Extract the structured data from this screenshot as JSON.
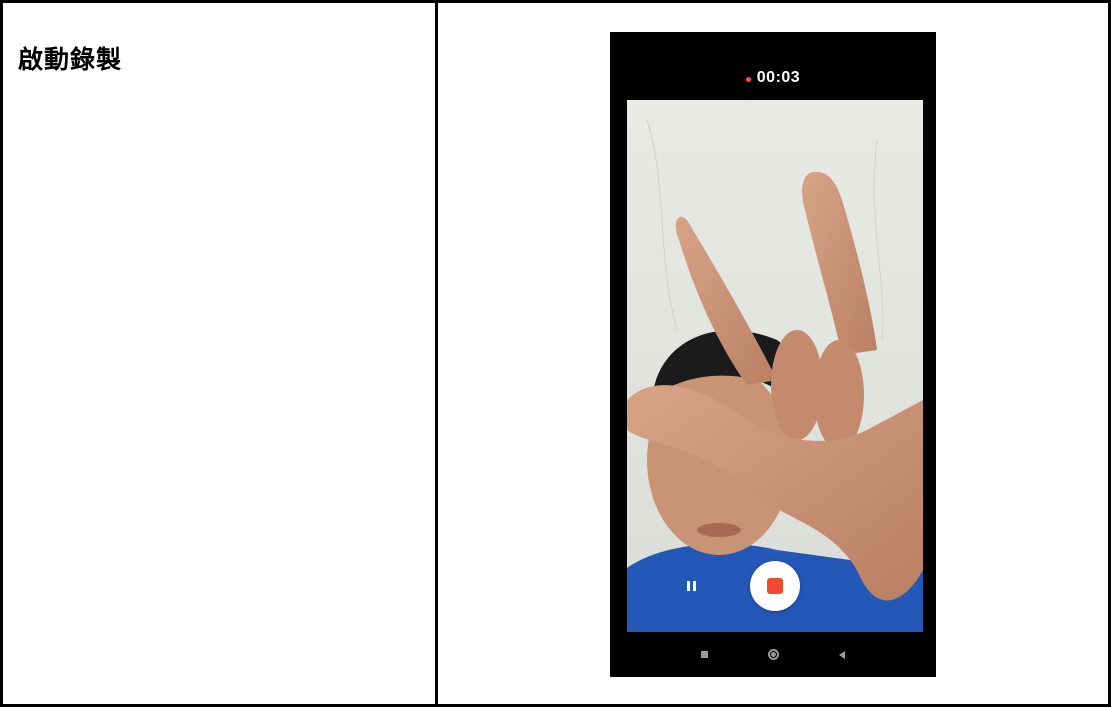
{
  "row": {
    "label": "啟動錄製"
  },
  "phone": {
    "recording": {
      "indicator_color": "#ff4d2e",
      "timer": "00:03"
    },
    "camera_view": {
      "subject": "person-making-hand-sign"
    },
    "controls": {
      "pause_icon": "pause-icon",
      "stop_icon": "stop-icon",
      "stop_color": "#ef4b32"
    },
    "nav_bar": {
      "icons": [
        "recents-icon",
        "home-icon",
        "back-icon"
      ]
    }
  }
}
